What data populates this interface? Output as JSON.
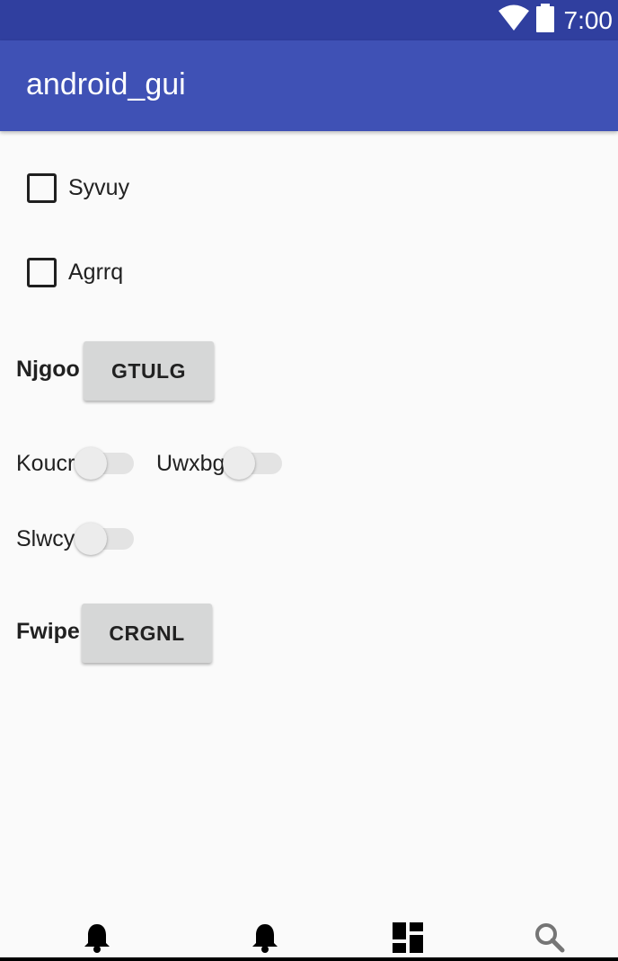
{
  "status_bar": {
    "time": "7:00",
    "icons": [
      "wifi-icon",
      "battery-icon"
    ]
  },
  "app_bar": {
    "title": "android_gui"
  },
  "checkboxes": [
    {
      "label": "Syvuy",
      "checked": false
    },
    {
      "label": "Agrrq",
      "checked": false
    }
  ],
  "row_njgoo": {
    "label": "Njgoo",
    "button_label": "GTULG"
  },
  "switches": [
    {
      "label": "Koucr",
      "on": false
    },
    {
      "label": "Uwxbg",
      "on": false
    },
    {
      "label": "Slwcy",
      "on": false
    }
  ],
  "row_fwipe": {
    "label": "Fwipe",
    "button_label": "CRGNL"
  },
  "bottom_nav": {
    "items": [
      "bell-icon",
      "bell-icon",
      "dashboard-icon",
      "search-icon"
    ]
  },
  "colors": {
    "status_bar": "#303f9f",
    "app_bar": "#3f51b5",
    "background": "#fafafa",
    "button": "#d6d7d7"
  }
}
